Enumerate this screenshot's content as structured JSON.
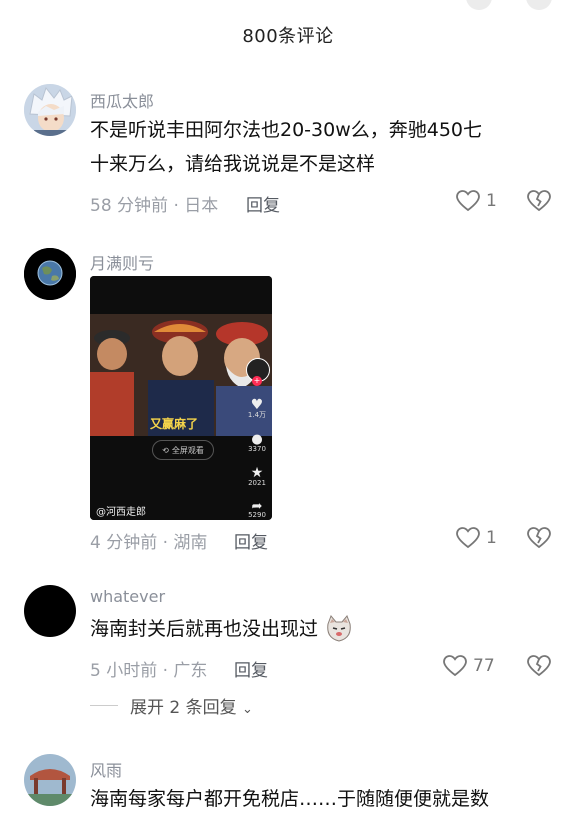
{
  "header": {
    "title": "800条评论"
  },
  "comments": [
    {
      "username": "西瓜太郎",
      "text_line1": "不是听说丰田阿尔法也20-30w么，奔驰450七",
      "text_line2": "十来万么，请给我说说是不是这样",
      "meta": "58 分钟前 · 日本",
      "reply_label": "回复",
      "likes": "1"
    },
    {
      "username": "月满则亏",
      "video": {
        "overlay_text": "又赢麻了",
        "fullscreen_label": "全屏观看",
        "watermark": "@河西走郎",
        "like_count": "1.4万",
        "comment_count": "3370",
        "fav_count": "2021",
        "share_count": "5290"
      },
      "meta": "4 分钟前 · 湖南",
      "reply_label": "回复",
      "likes": "1"
    },
    {
      "username": "whatever",
      "text": "海南封关后就再也没出现过",
      "meta": "5 小时前 · 广东",
      "reply_label": "回复",
      "likes": "77",
      "expand_label": "展开 2 条回复"
    },
    {
      "username": "风雨",
      "text": "海南每家每户都开免税店……于随随便便就是数"
    }
  ],
  "colors": {
    "username": "#8a8f99",
    "meta": "#9a9ea6",
    "text": "#111111"
  }
}
